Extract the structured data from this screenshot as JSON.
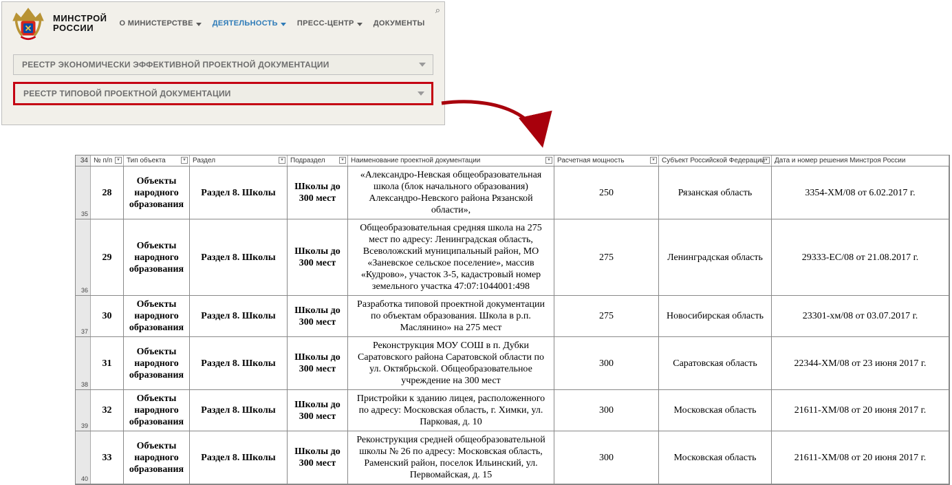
{
  "brand_line1": "МИНСТРОЙ",
  "brand_line2": "РОССИИ",
  "nav": {
    "about": "О МИНИСТЕРСТВЕ",
    "activity": "ДЕЯТЕЛЬНОСТЬ",
    "press": "ПРЕСС-ЦЕНТР",
    "docs": "ДОКУМЕНТЫ"
  },
  "dropdown1": "РЕЕСТР ЭКОНОМИЧЕСКИ ЭФФЕКТИВНОЙ ПРОЕКТНОЙ ДОКУМЕНТАЦИИ",
  "dropdown2": "РЕЕСТР ТИПОВОЙ ПРОЕКТНОЙ ДОКУМЕНТАЦИИ",
  "row_gutter_top": "34",
  "columns": {
    "np": "№ п/п",
    "typ": "Тип объекта",
    "raz": "Раздел",
    "pod": "Подраздел",
    "nam": "Наименование проектной документации",
    "mos": "Расчетная мощность",
    "sub": "Субъект Российской Федерации",
    "dat": "Дата и номер решения Минстроя России"
  },
  "rows": [
    {
      "rn": "35",
      "np": "28",
      "typ": "Объекты народного образования",
      "raz": "Раздел 8. Школы",
      "pod": "Школы до 300 мест",
      "nam": "«Александро-Невская общеобразовательная школа (блок начального образования) Александро-Невского района Рязанской области»,",
      "mos": "250",
      "sub": "Рязанская область",
      "dat": "3354-ХМ/08 от 6.02.2017 г."
    },
    {
      "rn": "36",
      "np": "29",
      "typ": "Объекты народного образования",
      "raz": "Раздел 8. Школы",
      "pod": "Школы до 300 мест",
      "nam": "Общеобразовательная средняя школа на 275 мест по адресу: Ленинградская область, Всеволожский муниципальный район, МО «Заневское сельское поселение», массив «Кудрово», участок 3-5, кадастровый номер земельного участка 47:07:1044001:498",
      "mos": "275",
      "sub": "Ленинградская область",
      "dat": "29333-ЕС/08 от 21.08.2017 г."
    },
    {
      "rn": "37",
      "np": "30",
      "typ": "Объекты народного образования",
      "raz": "Раздел 8. Школы",
      "pod": "Школы до 300 мест",
      "nam": "Разработка типовой проектной документации по объектам образования. Школа в р.п. Маслянино» на 275 мест",
      "mos": "275",
      "sub": "Новосибирская область",
      "dat": "23301-хм/08 от 03.07.2017 г."
    },
    {
      "rn": "38",
      "np": "31",
      "typ": "Объекты народного образования",
      "raz": "Раздел 8. Школы",
      "pod": "Школы до 300 мест",
      "nam": "Реконструкция МОУ СОШ в п. Дубки Саратовского района Саратовской области по ул. Октябрьской. Общеобразовательное учреждение на 300 мест",
      "mos": "300",
      "sub": "Саратовская область",
      "dat": "22344-ХМ/08 от 23 июня 2017 г."
    },
    {
      "rn": "39",
      "np": "32",
      "typ": "Объекты народного образования",
      "raz": "Раздел 8. Школы",
      "pod": "Школы до 300 мест",
      "nam": "Пристройки к зданию лицея, расположенного по адресу: Московская область, г. Химки, ул. Парковая, д. 10",
      "mos": "300",
      "sub": "Московская область",
      "dat": "21611-ХМ/08 от 20 июня 2017 г."
    },
    {
      "rn": "40",
      "np": "33",
      "typ": "Объекты народного образования",
      "raz": "Раздел 8. Школы",
      "pod": "Школы до 300 мест",
      "nam": "Реконструкция средней общеобразовательной школы № 26 по адресу: Московская область, Раменский район, поселок Ильинский, ул. Первомайская, д. 15",
      "mos": "300",
      "sub": "Московская область",
      "dat": "21611-ХМ/08 от 20 июня 2017 г."
    }
  ]
}
